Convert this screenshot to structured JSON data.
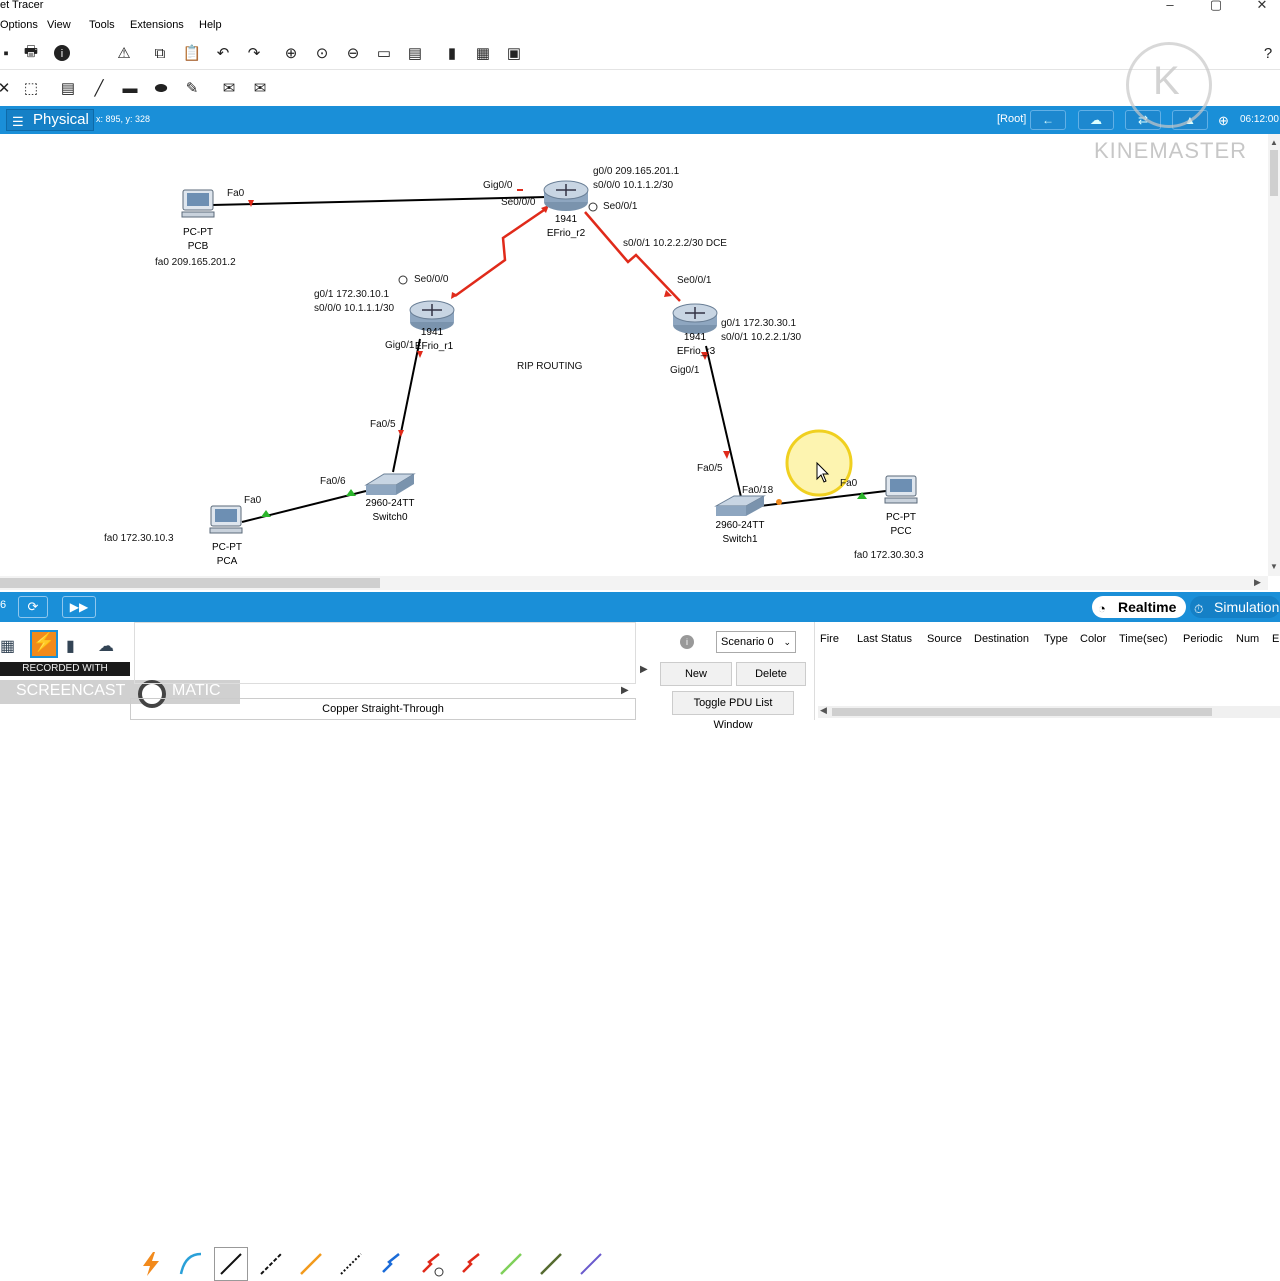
{
  "window": {
    "title": "et Tracer"
  },
  "menu": [
    "Options",
    "View",
    "Tools",
    "Extensions",
    "Help"
  ],
  "workspace": {
    "mode": "Physical",
    "cursor_coords": "x: 895, y: 328",
    "root_label": "[Root]",
    "clock": "06:12:00"
  },
  "topology": {
    "note": "RIP ROUTING",
    "devices": {
      "pcb": {
        "type": "PC-PT",
        "name": "PCB",
        "ip": "fa0 209.165.201.2"
      },
      "r2": {
        "model": "1941",
        "name": "EFrio_r2"
      },
      "r1": {
        "model": "1941",
        "name": "EFrio_r1"
      },
      "r3": {
        "model": "1941",
        "name": "EFrio_r3"
      },
      "sw0": {
        "model": "2960-24TT",
        "name": "Switch0"
      },
      "sw1": {
        "model": "2960-24TT",
        "name": "Switch1"
      },
      "pca": {
        "type": "PC-PT",
        "name": "PCA",
        "ip": "fa0 172.30.10.3"
      },
      "pcc": {
        "type": "PC-PT",
        "name": "PCC",
        "ip": "fa0 172.30.30.3"
      }
    },
    "port_labels": {
      "pcb_fa0": "Fa0",
      "r2_gig00": "Gig0/0",
      "r2_se000": "Se0/0/0",
      "r2_se001": "Se0/0/1",
      "r2_info1": "g0/0 209.165.201.1",
      "r2_info2": "s0/0/0 10.1.1.2/30",
      "r2_r3_link": "s0/0/1 10.2.2.2/30 DCE",
      "r1_se000": "Se0/0/0",
      "r1_info1": "g0/1 172.30.10.1",
      "r1_info2": "s0/0/0 10.1.1.1/30",
      "r1_gig01": "Gig0/1",
      "r3_se001": "Se0/0/1",
      "r3_info1": "g0/1 172.30.30.1",
      "r3_info2": "s0/0/1 10.2.2.1/30",
      "r3_gig01": "Gig0/1",
      "sw0_fa05": "Fa0/5",
      "sw0_fa06": "Fa0/6",
      "pca_fa0": "Fa0",
      "sw1_fa05": "Fa0/5",
      "sw1_fa018": "Fa0/18",
      "pcc_fa0": "Fa0"
    }
  },
  "bottom": {
    "left_counter": "6",
    "realtime": "Realtime",
    "simulation": "Simulation",
    "scenario": "Scenario 0",
    "new_label": "New",
    "delete_label": "Delete",
    "toggle_label": "Toggle PDU List Window",
    "connection_name": "Copper Straight-Through",
    "pdu_columns": [
      "Fire",
      "Last Status",
      "Source",
      "Destination",
      "Type",
      "Color",
      "Time(sec)",
      "Periodic",
      "Num",
      "E"
    ]
  },
  "overlay": {
    "recorded_with": "RECORDED WITH",
    "screencast": "SCREENCAST",
    "matic": "MATIC",
    "kinemaster": "KINEMASTER"
  },
  "colors": {
    "accent": "#1a8fd8",
    "serial_link": "#e02a1a",
    "link_down": "#e02a1a",
    "link_up": "#2bb52b"
  }
}
